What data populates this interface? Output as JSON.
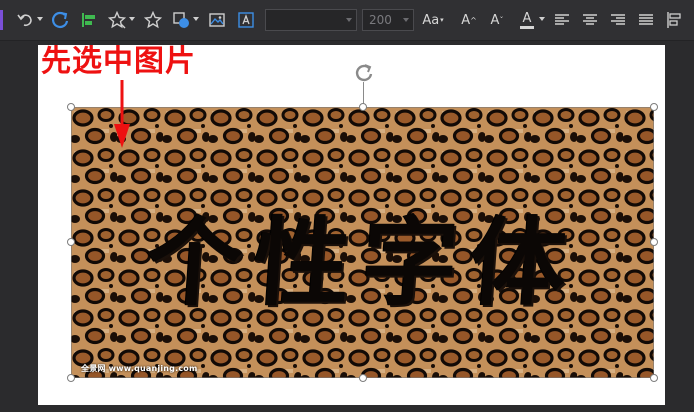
{
  "toolbar": {
    "font_name_value": "",
    "font_size_value": "200",
    "aa_label": "Aa",
    "grow_label": "A",
    "shrink_label": "A",
    "clear_label": "A",
    "font_color_label": "A",
    "colors": {
      "bar": "#303033",
      "icon": "#cfcfcf",
      "accent_blue": "#3d8ee6",
      "accent_green": "#3fb950",
      "accent_purple": "#7b4fd8"
    },
    "icons": [
      "undo-icon",
      "redo-refresh-icon",
      "align-icon",
      "star-shape-icon",
      "star-outline-icon",
      "shapes-icon",
      "image-icon",
      "textbox-icon",
      "change-case-icon",
      "grow-font-icon",
      "shrink-font-icon",
      "font-color-icon",
      "align-left-icon",
      "align-center-icon",
      "align-right-icon",
      "justify-icon",
      "arrange-icon"
    ]
  },
  "slide": {
    "annotation_text": "先选中图片",
    "annotation_color": "#ee1111",
    "picture": {
      "main_text": "个性字体",
      "watermark_text": "全景网 www.quanjing.com",
      "pattern": "leopard-print"
    }
  }
}
